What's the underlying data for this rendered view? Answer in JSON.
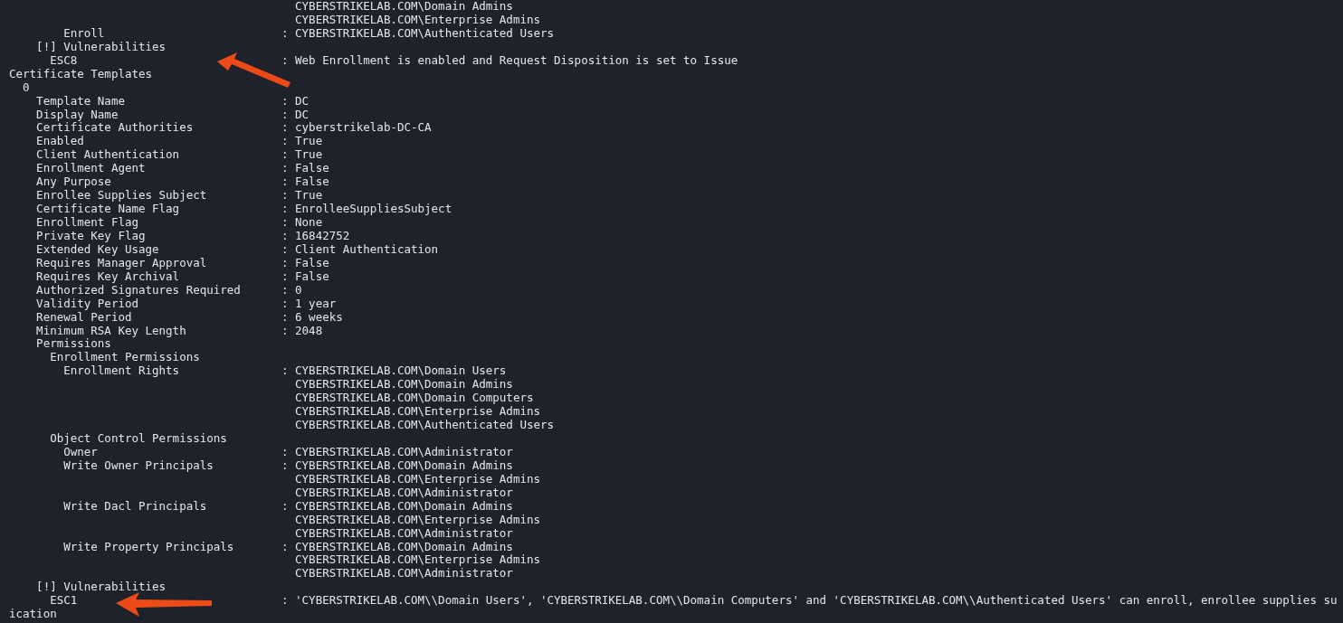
{
  "terminal": {
    "lines": [
      {
        "value": "  CYBERSTRIKELAB.COM\\Domain Admins"
      },
      {
        "value": "  CYBERSTRIKELAB.COM\\Enterprise Admins"
      },
      {
        "label": "        Enroll",
        "value": ": CYBERSTRIKELAB.COM\\Authenticated Users"
      },
      {
        "label": "    [!] Vulnerabilities"
      },
      {
        "label": "      ESC8",
        "value": ": Web Enrollment is enabled and Request Disposition is set to Issue"
      },
      {
        "label": "Certificate Templates"
      },
      {
        "label": "  0"
      },
      {
        "label": "    Template Name",
        "value": ": DC"
      },
      {
        "label": "    Display Name",
        "value": ": DC"
      },
      {
        "label": "    Certificate Authorities",
        "value": ": cyberstrikelab-DC-CA"
      },
      {
        "label": "    Enabled",
        "value": ": True"
      },
      {
        "label": "    Client Authentication",
        "value": ": True"
      },
      {
        "label": "    Enrollment Agent",
        "value": ": False"
      },
      {
        "label": "    Any Purpose",
        "value": ": False"
      },
      {
        "label": "    Enrollee Supplies Subject",
        "value": ": True"
      },
      {
        "label": "    Certificate Name Flag",
        "value": ": EnrolleeSuppliesSubject"
      },
      {
        "label": "    Enrollment Flag",
        "value": ": None"
      },
      {
        "label": "    Private Key Flag",
        "value": ": 16842752"
      },
      {
        "label": "    Extended Key Usage",
        "value": ": Client Authentication"
      },
      {
        "label": "    Requires Manager Approval",
        "value": ": False"
      },
      {
        "label": "    Requires Key Archival",
        "value": ": False"
      },
      {
        "label": "    Authorized Signatures Required",
        "value": ": 0"
      },
      {
        "label": "    Validity Period",
        "value": ": 1 year"
      },
      {
        "label": "    Renewal Period",
        "value": ": 6 weeks"
      },
      {
        "label": "    Minimum RSA Key Length",
        "value": ": 2048"
      },
      {
        "label": "    Permissions"
      },
      {
        "label": "      Enrollment Permissions"
      },
      {
        "label": "        Enrollment Rights",
        "value": ": CYBERSTRIKELAB.COM\\Domain Users"
      },
      {
        "value": "  CYBERSTRIKELAB.COM\\Domain Admins"
      },
      {
        "value": "  CYBERSTRIKELAB.COM\\Domain Computers"
      },
      {
        "value": "  CYBERSTRIKELAB.COM\\Enterprise Admins"
      },
      {
        "value": "  CYBERSTRIKELAB.COM\\Authenticated Users"
      },
      {
        "label": "      Object Control Permissions"
      },
      {
        "label": "        Owner",
        "value": ": CYBERSTRIKELAB.COM\\Administrator"
      },
      {
        "label": "        Write Owner Principals",
        "value": ": CYBERSTRIKELAB.COM\\Domain Admins"
      },
      {
        "value": "  CYBERSTRIKELAB.COM\\Enterprise Admins"
      },
      {
        "value": "  CYBERSTRIKELAB.COM\\Administrator"
      },
      {
        "label": "        Write Dacl Principals",
        "value": ": CYBERSTRIKELAB.COM\\Domain Admins"
      },
      {
        "value": "  CYBERSTRIKELAB.COM\\Enterprise Admins"
      },
      {
        "value": "  CYBERSTRIKELAB.COM\\Administrator"
      },
      {
        "label": "        Write Property Principals",
        "value": ": CYBERSTRIKELAB.COM\\Domain Admins"
      },
      {
        "value": "  CYBERSTRIKELAB.COM\\Enterprise Admins"
      },
      {
        "value": "  CYBERSTRIKELAB.COM\\Administrator"
      },
      {
        "label": "    [!] Vulnerabilities"
      },
      {
        "label": "      ESC1",
        "value": ": 'CYBERSTRIKELAB.COM\\\\Domain Users', 'CYBERSTRIKELAB.COM\\\\Domain Computers' and 'CYBERSTRIKELAB.COM\\\\Authenticated Users' can enroll, enrollee supplies su"
      },
      {
        "label": "ication"
      }
    ]
  }
}
